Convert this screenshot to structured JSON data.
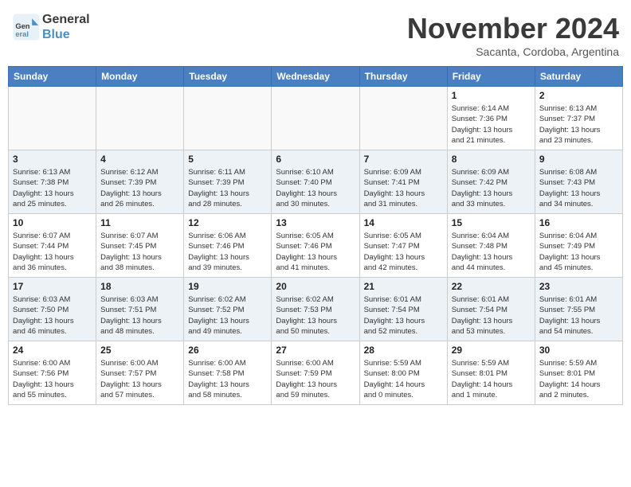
{
  "header": {
    "logo_line1": "General",
    "logo_line2": "Blue",
    "month_title": "November 2024",
    "subtitle": "Sacanta, Cordoba, Argentina"
  },
  "weekdays": [
    "Sunday",
    "Monday",
    "Tuesday",
    "Wednesday",
    "Thursday",
    "Friday",
    "Saturday"
  ],
  "weeks": [
    [
      {
        "day": "",
        "info": ""
      },
      {
        "day": "",
        "info": ""
      },
      {
        "day": "",
        "info": ""
      },
      {
        "day": "",
        "info": ""
      },
      {
        "day": "",
        "info": ""
      },
      {
        "day": "1",
        "info": "Sunrise: 6:14 AM\nSunset: 7:36 PM\nDaylight: 13 hours\nand 21 minutes."
      },
      {
        "day": "2",
        "info": "Sunrise: 6:13 AM\nSunset: 7:37 PM\nDaylight: 13 hours\nand 23 minutes."
      }
    ],
    [
      {
        "day": "3",
        "info": "Sunrise: 6:13 AM\nSunset: 7:38 PM\nDaylight: 13 hours\nand 25 minutes."
      },
      {
        "day": "4",
        "info": "Sunrise: 6:12 AM\nSunset: 7:39 PM\nDaylight: 13 hours\nand 26 minutes."
      },
      {
        "day": "5",
        "info": "Sunrise: 6:11 AM\nSunset: 7:39 PM\nDaylight: 13 hours\nand 28 minutes."
      },
      {
        "day": "6",
        "info": "Sunrise: 6:10 AM\nSunset: 7:40 PM\nDaylight: 13 hours\nand 30 minutes."
      },
      {
        "day": "7",
        "info": "Sunrise: 6:09 AM\nSunset: 7:41 PM\nDaylight: 13 hours\nand 31 minutes."
      },
      {
        "day": "8",
        "info": "Sunrise: 6:09 AM\nSunset: 7:42 PM\nDaylight: 13 hours\nand 33 minutes."
      },
      {
        "day": "9",
        "info": "Sunrise: 6:08 AM\nSunset: 7:43 PM\nDaylight: 13 hours\nand 34 minutes."
      }
    ],
    [
      {
        "day": "10",
        "info": "Sunrise: 6:07 AM\nSunset: 7:44 PM\nDaylight: 13 hours\nand 36 minutes."
      },
      {
        "day": "11",
        "info": "Sunrise: 6:07 AM\nSunset: 7:45 PM\nDaylight: 13 hours\nand 38 minutes."
      },
      {
        "day": "12",
        "info": "Sunrise: 6:06 AM\nSunset: 7:46 PM\nDaylight: 13 hours\nand 39 minutes."
      },
      {
        "day": "13",
        "info": "Sunrise: 6:05 AM\nSunset: 7:46 PM\nDaylight: 13 hours\nand 41 minutes."
      },
      {
        "day": "14",
        "info": "Sunrise: 6:05 AM\nSunset: 7:47 PM\nDaylight: 13 hours\nand 42 minutes."
      },
      {
        "day": "15",
        "info": "Sunrise: 6:04 AM\nSunset: 7:48 PM\nDaylight: 13 hours\nand 44 minutes."
      },
      {
        "day": "16",
        "info": "Sunrise: 6:04 AM\nSunset: 7:49 PM\nDaylight: 13 hours\nand 45 minutes."
      }
    ],
    [
      {
        "day": "17",
        "info": "Sunrise: 6:03 AM\nSunset: 7:50 PM\nDaylight: 13 hours\nand 46 minutes."
      },
      {
        "day": "18",
        "info": "Sunrise: 6:03 AM\nSunset: 7:51 PM\nDaylight: 13 hours\nand 48 minutes."
      },
      {
        "day": "19",
        "info": "Sunrise: 6:02 AM\nSunset: 7:52 PM\nDaylight: 13 hours\nand 49 minutes."
      },
      {
        "day": "20",
        "info": "Sunrise: 6:02 AM\nSunset: 7:53 PM\nDaylight: 13 hours\nand 50 minutes."
      },
      {
        "day": "21",
        "info": "Sunrise: 6:01 AM\nSunset: 7:54 PM\nDaylight: 13 hours\nand 52 minutes."
      },
      {
        "day": "22",
        "info": "Sunrise: 6:01 AM\nSunset: 7:54 PM\nDaylight: 13 hours\nand 53 minutes."
      },
      {
        "day": "23",
        "info": "Sunrise: 6:01 AM\nSunset: 7:55 PM\nDaylight: 13 hours\nand 54 minutes."
      }
    ],
    [
      {
        "day": "24",
        "info": "Sunrise: 6:00 AM\nSunset: 7:56 PM\nDaylight: 13 hours\nand 55 minutes."
      },
      {
        "day": "25",
        "info": "Sunrise: 6:00 AM\nSunset: 7:57 PM\nDaylight: 13 hours\nand 57 minutes."
      },
      {
        "day": "26",
        "info": "Sunrise: 6:00 AM\nSunset: 7:58 PM\nDaylight: 13 hours\nand 58 minutes."
      },
      {
        "day": "27",
        "info": "Sunrise: 6:00 AM\nSunset: 7:59 PM\nDaylight: 13 hours\nand 59 minutes."
      },
      {
        "day": "28",
        "info": "Sunrise: 5:59 AM\nSunset: 8:00 PM\nDaylight: 14 hours\nand 0 minutes."
      },
      {
        "day": "29",
        "info": "Sunrise: 5:59 AM\nSunset: 8:01 PM\nDaylight: 14 hours\nand 1 minute."
      },
      {
        "day": "30",
        "info": "Sunrise: 5:59 AM\nSunset: 8:01 PM\nDaylight: 14 hours\nand 2 minutes."
      }
    ]
  ]
}
